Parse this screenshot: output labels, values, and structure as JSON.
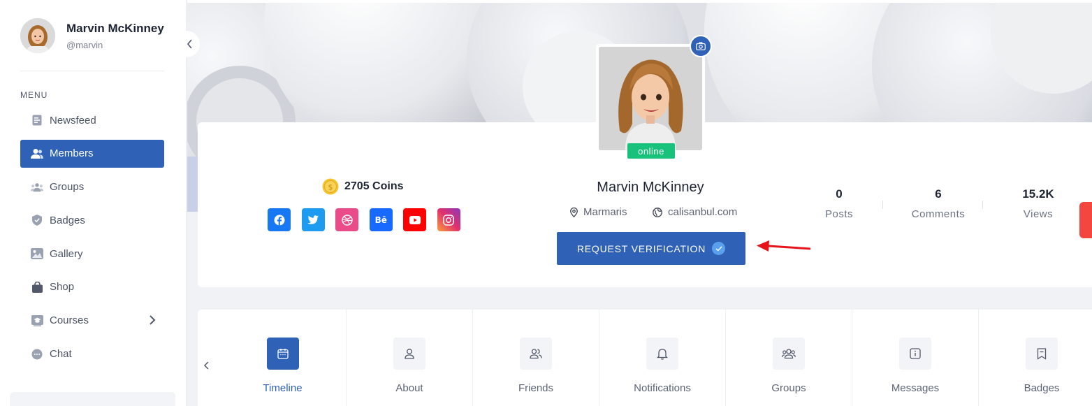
{
  "sidebar": {
    "user": {
      "name": "Marvin McKinney",
      "handle": "@marvin"
    },
    "menu_label": "MENU",
    "items": [
      {
        "label": "Newsfeed",
        "icon": "document-icon",
        "active": false
      },
      {
        "label": "Members",
        "icon": "user-icon",
        "active": true
      },
      {
        "label": "Groups",
        "icon": "group-icon",
        "active": false
      },
      {
        "label": "Badges",
        "icon": "shield-icon",
        "active": false
      },
      {
        "label": "Gallery",
        "icon": "image-icon",
        "active": false
      },
      {
        "label": "Shop",
        "icon": "bag-icon",
        "active": false
      },
      {
        "label": "Courses",
        "icon": "course-icon",
        "active": false,
        "has_submenu": true
      },
      {
        "label": "Chat",
        "icon": "chat-icon",
        "active": false
      }
    ]
  },
  "profile": {
    "name": "Marvin McKinney",
    "status": "online",
    "location": "Marmaris",
    "website": "calisanbul.com",
    "verify_button_label": "REQUEST VERIFICATION",
    "coins_label": "2705 Coins",
    "socials": [
      "facebook",
      "twitter",
      "dribbble",
      "behance",
      "youtube",
      "instagram"
    ],
    "behance_glyph": "Bē",
    "stats": [
      {
        "value": "0",
        "label": "Posts"
      },
      {
        "value": "6",
        "label": "Comments"
      },
      {
        "value": "15.2K",
        "label": "Views"
      }
    ]
  },
  "tabs": [
    {
      "label": "Timeline",
      "icon": "calendar-icon",
      "active": true
    },
    {
      "label": "About",
      "icon": "user-icon",
      "active": false
    },
    {
      "label": "Friends",
      "icon": "friends-icon",
      "active": false
    },
    {
      "label": "Notifications",
      "icon": "bell-icon",
      "active": false
    },
    {
      "label": "Groups",
      "icon": "group-icon",
      "active": false
    },
    {
      "label": "Messages",
      "icon": "info-icon",
      "active": false
    },
    {
      "label": "Badges",
      "icon": "bookmark-icon",
      "active": false
    }
  ],
  "colors": {
    "accent": "#2f62b6",
    "online": "#19c27b",
    "annotation_arrow": "#e8141c",
    "coin": "#f4c430"
  }
}
